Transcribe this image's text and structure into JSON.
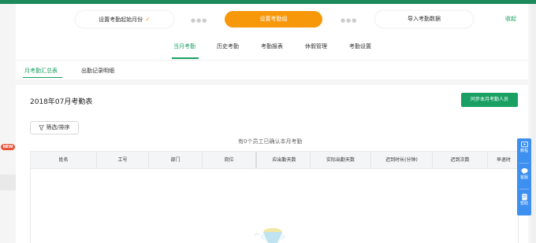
{
  "steps": [
    {
      "label": "设置考勤起始月份",
      "done": true
    },
    {
      "label": "设置考勤组"
    },
    {
      "label": "导入考勤数据"
    }
  ],
  "collapse_label": "收起",
  "main_tabs": [
    "当月考勤",
    "历史考勤",
    "考勤报表",
    "休假管理",
    "考勤设置"
  ],
  "sub_tabs": [
    "月考勤汇总表",
    "出勤记录明细"
  ],
  "page_title": "2018年07月考勤表",
  "sync_button": "同步本月考勤人员",
  "filter_button": "筛选/排序",
  "confirm_text": "有0个员工已确认本月考勤",
  "table": {
    "columns": [
      "姓名",
      "工号",
      "部门",
      "岗位",
      "应出勤天数",
      "实际出勤天数",
      "迟到时长(分钟)",
      "迟到次数",
      "早退时"
    ]
  },
  "badge": "NEW",
  "float_panel": [
    {
      "icon": "tutorial-icon",
      "label": "教程"
    },
    {
      "icon": "chat-icon",
      "label": "客服"
    },
    {
      "icon": "help-book-icon",
      "label": "帮助"
    }
  ],
  "colors": {
    "brand_green": "#1aa063",
    "active_orange": "#f7980b",
    "float_blue": "#3d8ff0",
    "new_red": "#e8553d"
  }
}
